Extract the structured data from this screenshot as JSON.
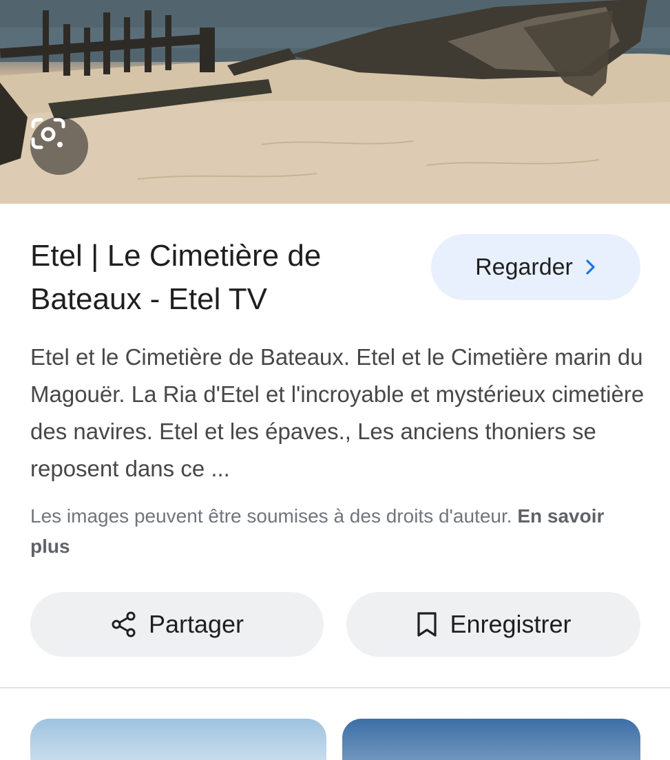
{
  "hero": {
    "image_description_name": "shipwreck-on-sand-image",
    "lens_icon": "google-lens-icon"
  },
  "result": {
    "title": "Etel | Le Cimetière de Bateaux - Etel TV",
    "watch_label": "Regarder",
    "watch_icon": "chevron-right-icon",
    "description": "Etel et le Cimetière de Bateaux. Etel et le Cimetière marin du Magouër. La Ria d'Etel et l'incroyable et mystérieux cimetière des navires. Etel et les épaves., Les anciens thoniers se reposent dans ce ...",
    "copyright_notice": "Les images peuvent être soumises à des droits d'auteur.",
    "learn_more_label": "En savoir plus"
  },
  "actions": {
    "share_label": "Partager",
    "share_icon": "share-icon",
    "save_label": "Enregistrer",
    "save_icon": "bookmark-icon"
  },
  "colors": {
    "accent_button_bg": "#e8f0fe",
    "chevron": "#1a73e8",
    "action_button_bg": "#eef0f2"
  }
}
